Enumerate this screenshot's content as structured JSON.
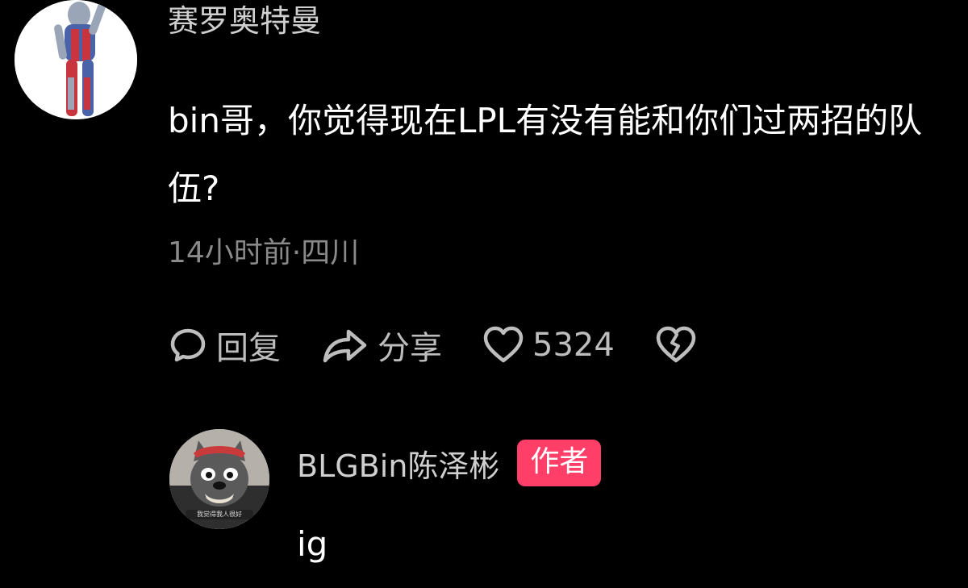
{
  "comment": {
    "username": "赛罗奥特曼",
    "text": "bin哥，你觉得现在LPL有没有能和你们过两招的队伍?",
    "meta": "14小时前·四川",
    "actions": {
      "reply_label": "回复",
      "share_label": "分享",
      "like_count": "5324"
    }
  },
  "reply": {
    "username": "BLGBin陈泽彬",
    "badge": "作者",
    "text": "ig",
    "avatar_caption": "我觉得我人很好"
  },
  "colors": {
    "background": "#000000",
    "username": "#cfcfcf",
    "meta": "#8a8a8a",
    "action": "#bdbdbd",
    "badge": "#ff3f67"
  },
  "icons": {
    "reply": "comment-bubble-icon",
    "share": "share-arrow-icon",
    "like": "heart-icon",
    "dislike": "broken-heart-icon"
  }
}
